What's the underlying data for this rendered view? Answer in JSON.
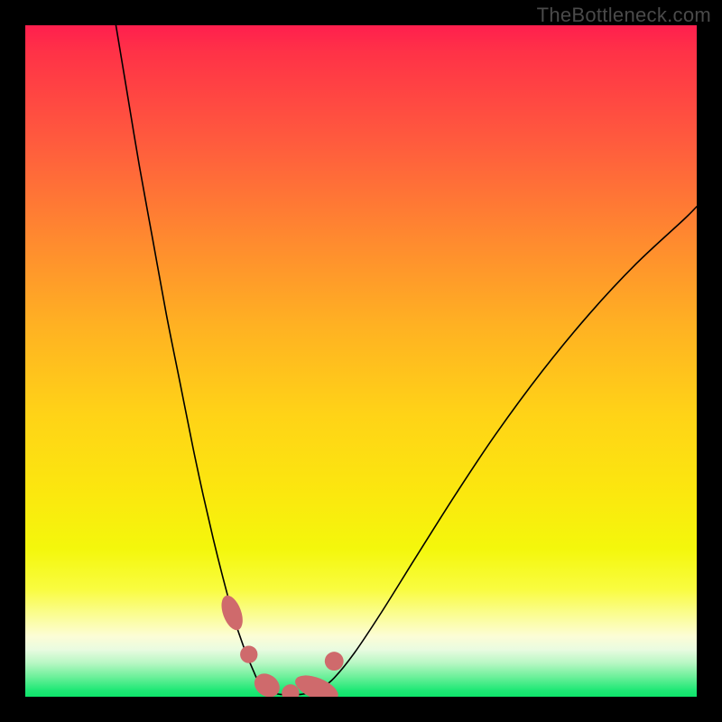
{
  "watermark": "TheBottleneck.com",
  "colors": {
    "marker": "#cf6a6c",
    "curve": "#000000",
    "frame": "#000000",
    "gradient_top": "#ff1f4e",
    "gradient_bottom": "#0ee46a"
  },
  "chart_data": {
    "type": "line",
    "title": "",
    "xlabel": "",
    "ylabel": "",
    "xlim": [
      0,
      100
    ],
    "ylim": [
      0,
      100
    ],
    "grid": false,
    "legend": false,
    "annotations": [
      "TheBottleneck.com"
    ],
    "series": [
      {
        "name": "left-branch",
        "x": [
          13.5,
          15,
          17,
          19,
          21,
          23,
          25,
          26.5,
          28,
          29.5,
          31,
          32.5,
          34,
          35
        ],
        "y": [
          100,
          91,
          79,
          68,
          57,
          47,
          37,
          30,
          23.5,
          17.5,
          12,
          7.5,
          3.8,
          1.8
        ]
      },
      {
        "name": "valley-floor",
        "x": [
          35,
          36.5,
          38,
          39.5,
          41,
          42.5,
          44
        ],
        "y": [
          1.8,
          0.7,
          0.35,
          0.3,
          0.35,
          0.6,
          1.2
        ]
      },
      {
        "name": "right-branch",
        "x": [
          44,
          46,
          49,
          53,
          58,
          64,
          70,
          77,
          84,
          91,
          98,
          100
        ],
        "y": [
          1.2,
          2.8,
          6.5,
          12.5,
          20.5,
          30,
          39,
          48.5,
          57,
          64.5,
          71,
          73
        ]
      }
    ],
    "markers": [
      {
        "name": "left-blob-top",
        "x": 30.8,
        "y": 12.5,
        "rx": 1.35,
        "ry": 2.7,
        "angle": -20
      },
      {
        "name": "left-dot-mid",
        "x": 33.3,
        "y": 6.3,
        "rx": 1.3,
        "ry": 1.3,
        "angle": 0
      },
      {
        "name": "floor-blob-left",
        "x": 36.0,
        "y": 1.7,
        "rx": 1.6,
        "ry": 2.0,
        "angle": -55
      },
      {
        "name": "floor-dot-center",
        "x": 39.5,
        "y": 0.55,
        "rx": 1.3,
        "ry": 1.3,
        "angle": 0
      },
      {
        "name": "floor-blob-right",
        "x": 43.4,
        "y": 1.25,
        "rx": 3.4,
        "ry": 1.55,
        "angle": 22
      },
      {
        "name": "right-dot-above",
        "x": 46.0,
        "y": 5.3,
        "rx": 1.4,
        "ry": 1.4,
        "angle": 0
      }
    ]
  }
}
